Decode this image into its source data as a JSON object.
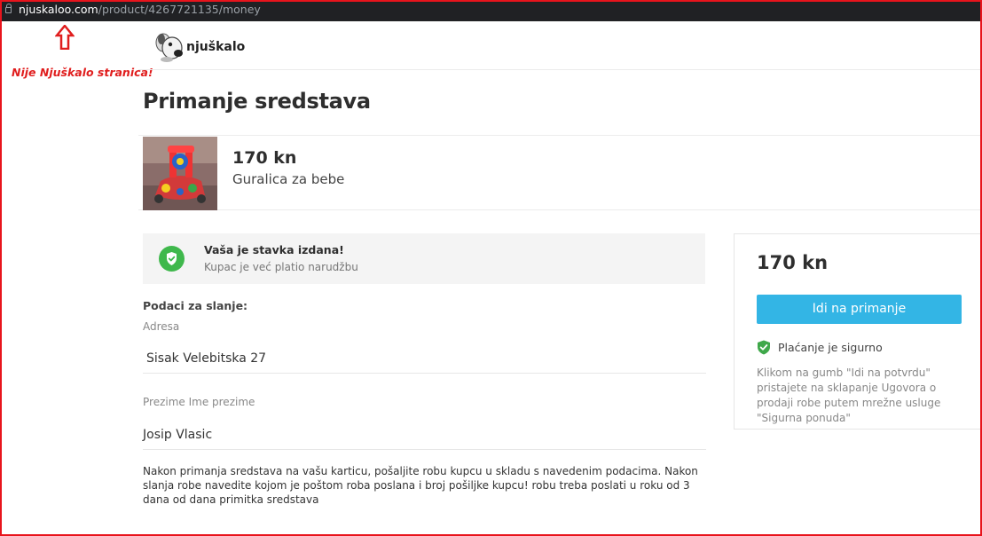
{
  "browser": {
    "url_host": "njuskaloo.com",
    "url_path": "/product/4267721135/money"
  },
  "annotation": {
    "warning_text": "Nije Njuškalo stranica!",
    "arrow_color": "#e01e1e"
  },
  "header": {
    "logo_text": "njuškalo",
    "logo_icon": "njuskalo-dog-mascot-icon"
  },
  "page": {
    "title": "Primanje sredstava"
  },
  "product": {
    "price": "170 kn",
    "name": "Guralica za bebe",
    "thumbnail": "baby-walker-toy-image"
  },
  "notice": {
    "icon": "shield-check-icon",
    "title": "Vaša je stavka izdana!",
    "subtitle": "Kupac je već platio narudžbu"
  },
  "shipping": {
    "section_label": "Podaci za slanje:",
    "address_label": "Adresa",
    "address_value": "Sisak Velebitska 27",
    "name_label": "Prezime Ime prezime",
    "name_value": "Josip Vlasic"
  },
  "info_text": "Nakon primanja sredstava na vašu karticu, pošaljite robu kupcu u skladu s navedenim podacima. Nakon slanja robe navedite kojom je poštom roba poslana i broj pošiljke kupcu! robu treba poslati u roku od 3 dana od dana primitka sredstava",
  "sidebar": {
    "price": "170 kn",
    "button_label": "Idi na primanje",
    "secure_label": "Plaćanje je sigurno",
    "secure_icon": "shield-check-icon",
    "terms": "Klikom na gumb \"Idi na potvrdu\" pristajete na sklapanje Ugovora o prodaji robe putem mrežne usluge \"Sigurna ponuda\""
  },
  "colors": {
    "frame_border": "#e8141c",
    "button_bg": "#33b5e5",
    "success_green": "#3fb84c"
  }
}
